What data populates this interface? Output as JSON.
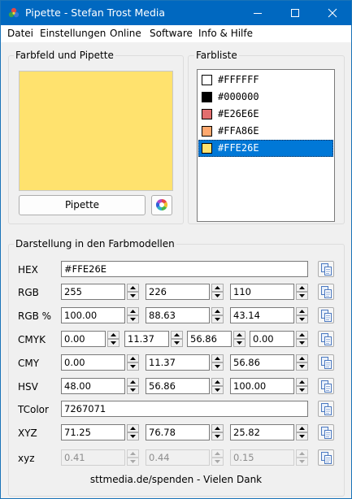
{
  "window": {
    "title": "Pipette - Stefan Trost Media"
  },
  "menu": [
    "Datei",
    "Einstellungen",
    "Online",
    "Software",
    "Info & Hilfe"
  ],
  "color_group": {
    "label": "Farbfeld und Pipette",
    "swatch_color": "#FFE26E",
    "pipette_label": "Pipette"
  },
  "list_group": {
    "label": "Farbliste",
    "items": [
      {
        "label": "#FFFFFF",
        "color": "#FFFFFF"
      },
      {
        "label": "#000000",
        "color": "#000000"
      },
      {
        "label": "#E26E6E",
        "color": "#E26E6E"
      },
      {
        "label": "#FFA86E",
        "color": "#FFA86E"
      },
      {
        "label": "#FFE26E",
        "color": "#FFE26E",
        "selected": true
      }
    ]
  },
  "models": {
    "label": "Darstellung in den Farbmodellen",
    "hex": {
      "label": "HEX",
      "value": "#FFE26E"
    },
    "rgb": {
      "label": "RGB",
      "values": [
        "255",
        "226",
        "110"
      ]
    },
    "rgb_pct": {
      "label": "RGB %",
      "values": [
        "100.00",
        "88.63",
        "43.14"
      ]
    },
    "cmyk": {
      "label": "CMYK",
      "values": [
        "0.00",
        "11.37",
        "56.86",
        "0.00"
      ]
    },
    "cmy": {
      "label": "CMY",
      "values": [
        "0.00",
        "11.37",
        "56.86"
      ]
    },
    "hsv": {
      "label": "HSV",
      "values": [
        "48.00",
        "56.86",
        "100.00"
      ]
    },
    "tcolor": {
      "label": "TColor",
      "value": "7267071"
    },
    "xyz": {
      "label": "XYZ",
      "values": [
        "71.25",
        "76.78",
        "25.82"
      ]
    },
    "xyz_small": {
      "label": "xyz",
      "values": [
        "0.41",
        "0.44",
        "0.15"
      ]
    }
  },
  "footer": "sttmedia.de/spenden - Vielen Dank",
  "colors": {
    "titlebar": "#0068C0",
    "selection": "#0078D7"
  }
}
